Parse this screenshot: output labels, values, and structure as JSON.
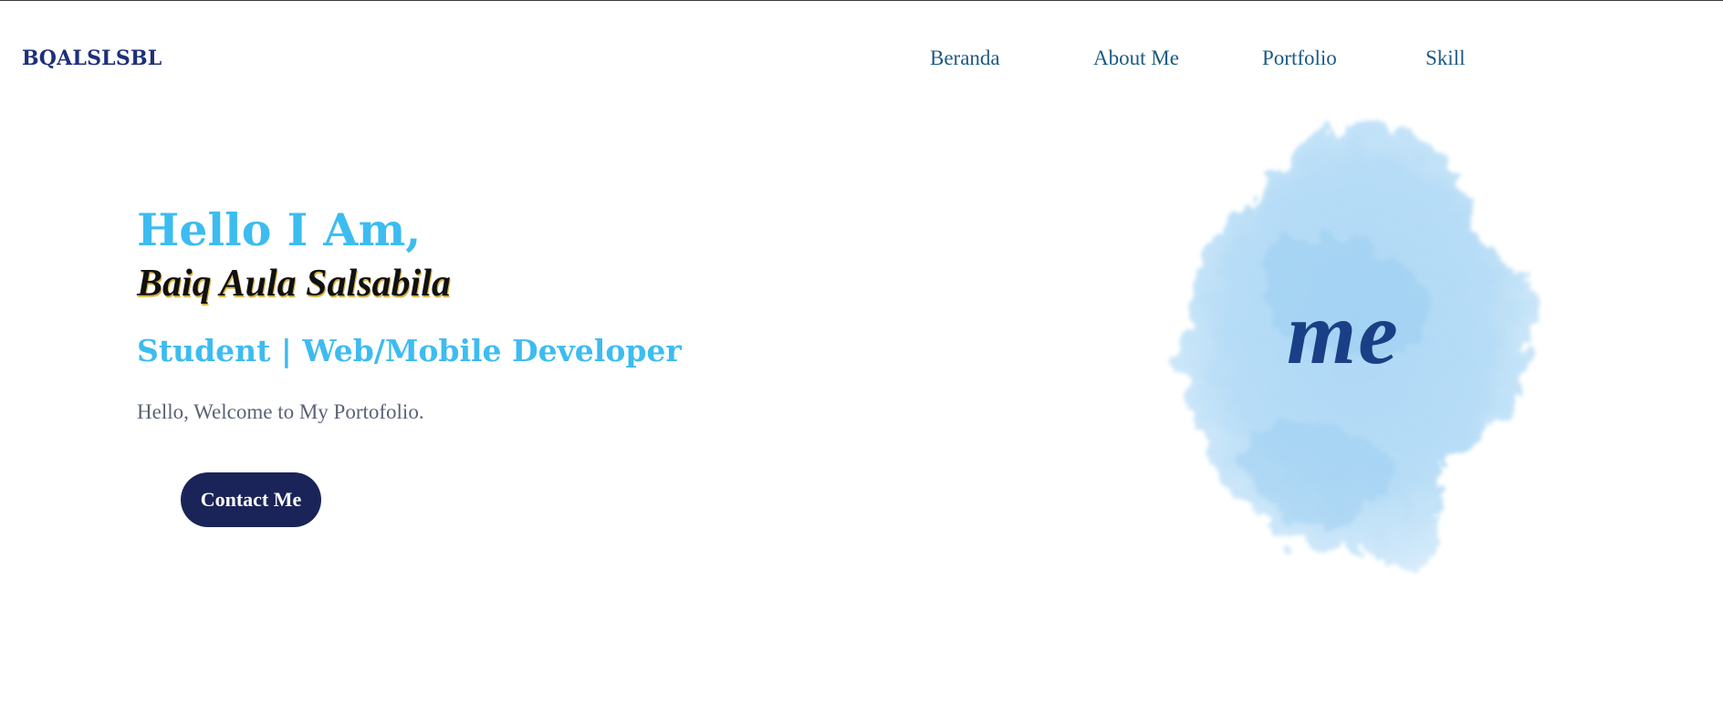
{
  "brand": {
    "logo": "BQALSLSBL",
    "accent_color": "#1e2f7a"
  },
  "nav": {
    "items": [
      {
        "label": "Beranda"
      },
      {
        "label": "About Me"
      },
      {
        "label": "Portfolio"
      },
      {
        "label": "Skill"
      }
    ],
    "link_color": "#1b5a85"
  },
  "hero": {
    "greeting": "Hello I Am,",
    "name": "Baiq Aula Salsabila",
    "role": "Student | Web/Mobile Developer",
    "welcome": "Hello, Welcome to My Portofolio.",
    "cta_label": "Contact Me",
    "accent_color": "#3dbcf0",
    "button_color": "#1b2458"
  },
  "illustration": {
    "text": "me",
    "blob_color": "#a9d6f5",
    "text_color": "#1a3f86"
  }
}
